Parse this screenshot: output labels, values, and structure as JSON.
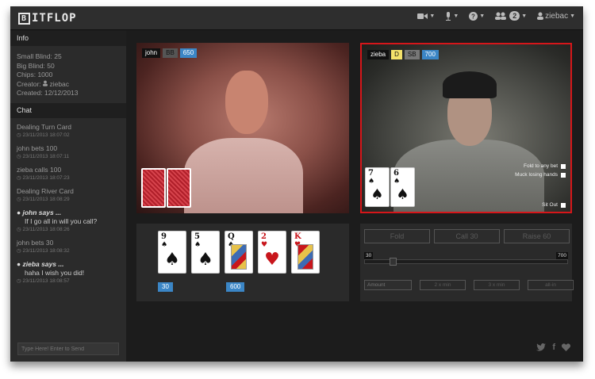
{
  "app": {
    "logo_letter": "B",
    "logo_text": "ITFLOP"
  },
  "nav": {
    "online_count": "2",
    "username": "ziebac"
  },
  "sidebar": {
    "info_title": "Info",
    "info_lines": {
      "small_blind": "Small Blind: 25",
      "big_blind": "Big Blind: 50",
      "chips": "Chips: 1000",
      "creator_label": "Creator:",
      "creator_name": "ziebac",
      "created": "Created: 12/12/2013"
    },
    "chat_title": "Chat",
    "chat_input_placeholder": "Type Here! Enter to Send",
    "messages": [
      {
        "text": "Dealing Turn Card",
        "time": "23/11/2013 18:07:02"
      },
      {
        "text": "john bets 100",
        "time": "23/11/2013 18:07:11"
      },
      {
        "text": "zieba calls 100",
        "time": "23/11/2013 18:07:23"
      },
      {
        "text": "Dealing River Card",
        "time": "23/11/2013 18:08:29"
      },
      {
        "says": "john says ...",
        "body": "If I go all in will you call?",
        "time": "23/11/2013 18:08:26"
      },
      {
        "text": "john bets 30",
        "time": "23/11/2013 18:08:32"
      },
      {
        "says": "zieba says ...",
        "body": "haha I wish you did!",
        "time": "23/11/2013 18:08:57"
      }
    ]
  },
  "players": {
    "left": {
      "name": "john",
      "position": "BB",
      "chips": "650"
    },
    "right": {
      "name": "zieba",
      "dealer": "D",
      "position": "SB",
      "chips": "700",
      "hole_cards": [
        {
          "rank": "7",
          "suit": "♠"
        },
        {
          "rank": "6",
          "suit": "♠"
        }
      ],
      "options": {
        "fold_to_any": "Fold to any bet",
        "muck": "Muck losing hands",
        "sit_out": "Sit Out"
      }
    }
  },
  "board": {
    "cards": [
      {
        "rank": "9",
        "suit": "♠",
        "color": "black"
      },
      {
        "rank": "5",
        "suit": "♠",
        "color": "black"
      },
      {
        "rank": "Q",
        "suit": "♠",
        "color": "black"
      },
      {
        "rank": "2",
        "suit": "♥",
        "color": "red"
      },
      {
        "rank": "K",
        "suit": "♥",
        "color": "red"
      }
    ],
    "bets": [
      "30",
      "600"
    ]
  },
  "actions": {
    "fold": "Fold",
    "call": "Call 30",
    "raise": "Raise 60",
    "slider_min": "30",
    "slider_max": "700",
    "slider_value_fraction": 0.05,
    "amount_placeholder": "Amount",
    "quick": [
      "2 x min",
      "3 x min",
      "all-in"
    ]
  }
}
